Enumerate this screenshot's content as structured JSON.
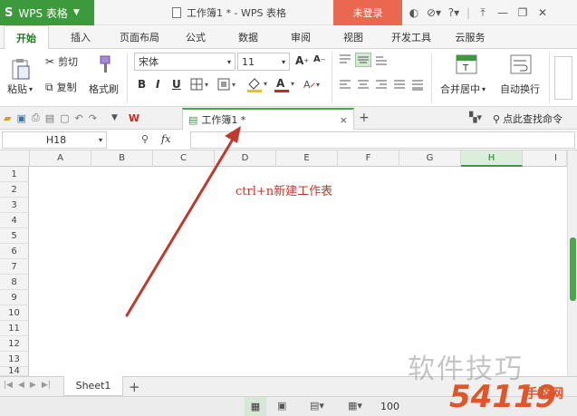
{
  "title_bar": {
    "app_name": "WPS 表格",
    "app_logo": "S",
    "window_title": "工作簿1 * - WPS 表格",
    "login_button": "未登录",
    "icons": [
      "skin-icon",
      "share-icon",
      "help-icon",
      "ribbon-collapse-icon",
      "minimize-icon",
      "restore-icon",
      "close-icon"
    ]
  },
  "menu_tabs": [
    "开始",
    "插入",
    "页面布局",
    "公式",
    "数据",
    "审阅",
    "视图",
    "开发工具",
    "云服务"
  ],
  "active_tab": "开始",
  "ribbon": {
    "cut_label": "剪切",
    "paste_label": "粘贴",
    "copy_label": "复制",
    "format_painter_label": "格式刷",
    "font_name": "宋体",
    "font_size": "11",
    "merge_center_label": "合并居中",
    "wrap_text_label": "自动换行",
    "bold": "B",
    "italic": "I",
    "underline": "U"
  },
  "quick_bar": {
    "doc_tab_title": "工作簿1 *",
    "search_command": "点此查找命令"
  },
  "formula_bar": {
    "name_box": "H18",
    "fx_label": "fx",
    "formula_value": ""
  },
  "grid": {
    "columns": [
      "A",
      "B",
      "C",
      "D",
      "E",
      "F",
      "G",
      "H",
      "I"
    ],
    "selected_column": "H",
    "rows": [
      "1",
      "2",
      "3",
      "4",
      "5",
      "6",
      "7",
      "8",
      "9",
      "10",
      "11",
      "12",
      "13",
      "14"
    ]
  },
  "annotation": {
    "text": "ctrl+n新建工作表",
    "color": "#c0392b"
  },
  "sheet_tabs": {
    "tabs": [
      "Sheet1"
    ],
    "add_symbol": "+"
  },
  "status_bar": {
    "zoom": "100"
  },
  "watermark": {
    "text1": "软件技巧",
    "text2": "54119",
    "text3": "手游网"
  },
  "colors": {
    "accent_green": "#3c9a3c",
    "login_red": "#e9684f"
  }
}
